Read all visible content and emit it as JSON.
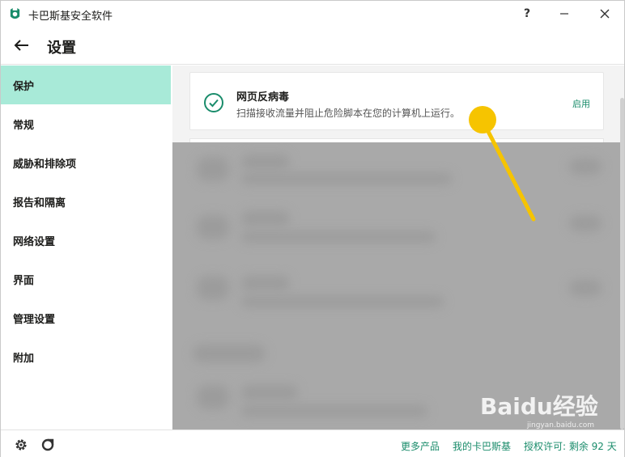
{
  "window": {
    "title": "卡巴斯基安全软件",
    "help_label": "?",
    "minimize_label": "—",
    "close_label": "✕"
  },
  "header": {
    "title": "设置",
    "back_icon": "arrow-left-icon"
  },
  "sidebar": {
    "items": [
      {
        "label": "保护",
        "active": true
      },
      {
        "label": "常规",
        "active": false
      },
      {
        "label": "威胁和排除项",
        "active": false
      },
      {
        "label": "报告和隔离",
        "active": false
      },
      {
        "label": "网络设置",
        "active": false
      },
      {
        "label": "界面",
        "active": false
      },
      {
        "label": "管理设置",
        "active": false
      },
      {
        "label": "附加",
        "active": false
      }
    ]
  },
  "main": {
    "card": {
      "icon": "check-circle-icon",
      "title": "网页反病毒",
      "description": "扫描接收流量并阻止危险脚本在您的计算机上运行。",
      "status": "启用"
    }
  },
  "footer": {
    "settings_icon": "gear-icon",
    "support_icon": "support-icon",
    "more_products": "更多产品",
    "my_kaspersky": "我的卡巴斯基",
    "license": "授权许可: 剩余 92 天"
  },
  "watermark": {
    "text": "Baidu经验",
    "sub": "jingyan.baidu.com"
  },
  "colors": {
    "accent": "#1a8c6b",
    "sidebar_active": "#a8ead8",
    "pointer": "#f6c400"
  }
}
